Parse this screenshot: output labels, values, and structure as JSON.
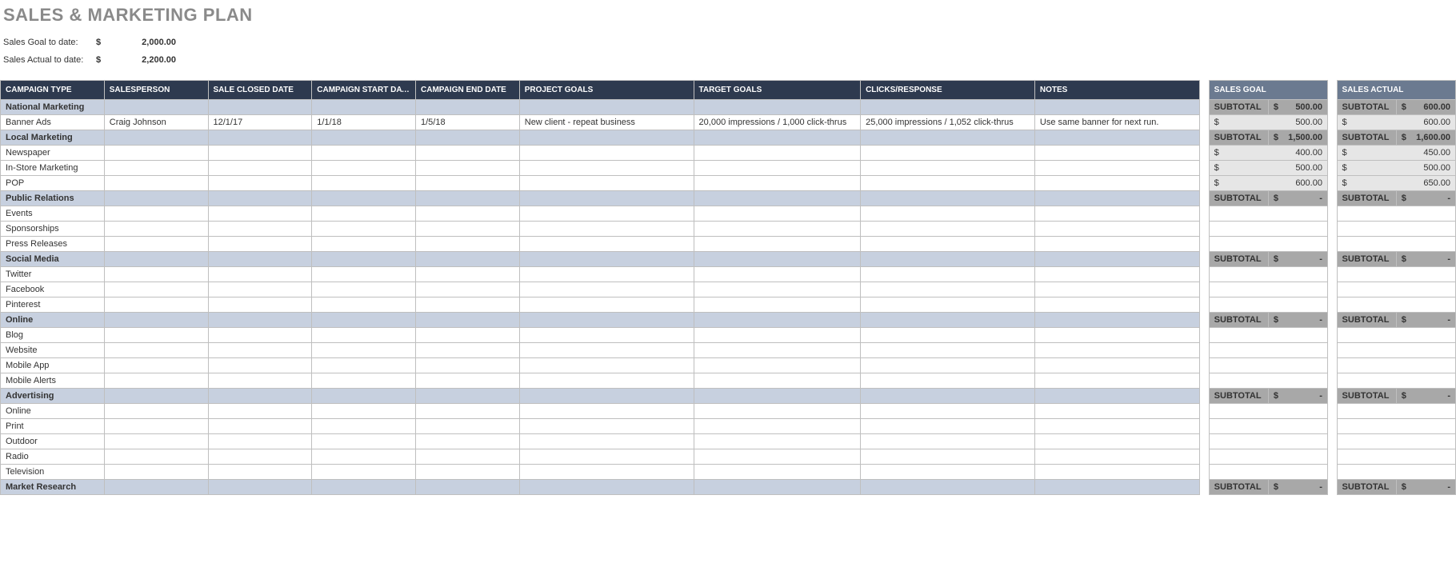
{
  "title": "SALES & MARKETING PLAN",
  "summary": {
    "goal_label": "Sales Goal to date:",
    "goal_sym": "$",
    "goal_val": "2,000.00",
    "actual_label": "Sales Actual to date:",
    "actual_sym": "$",
    "actual_val": "2,200.00"
  },
  "headers": {
    "campaign_type": "CAMPAIGN TYPE",
    "salesperson": "SALESPERSON",
    "sale_closed": "SALE CLOSED DATE",
    "start": "CAMPAIGN START DATE",
    "end": "CAMPAIGN END DATE",
    "project_goals": "PROJECT GOALS",
    "target_goals": "TARGET GOALS",
    "clicks": "CLICKS/RESPONSE",
    "notes": "NOTES",
    "sales_goal": "SALES GOAL",
    "sales_actual": "SALES ACTUAL"
  },
  "subtotal_label": "SUBTOTAL",
  "sections": [
    {
      "name": "National Marketing",
      "goal": "500.00",
      "actual": "600.00",
      "items": [
        {
          "type": "Banner Ads",
          "salesperson": "Craig Johnson",
          "closed": "12/1/17",
          "start": "1/1/18",
          "end": "1/5/18",
          "project": "New client - repeat business",
          "target": "20,000 impressions / 1,000 click-thrus",
          "clicks": "25,000 impressions / 1,052 click-thrus",
          "notes": "Use same banner for next run.",
          "goal": "500.00",
          "actual": "600.00"
        }
      ]
    },
    {
      "name": "Local Marketing",
      "goal": "1,500.00",
      "actual": "1,600.00",
      "items": [
        {
          "type": "Newspaper",
          "goal": "400.00",
          "actual": "450.00"
        },
        {
          "type": "In-Store Marketing",
          "goal": "500.00",
          "actual": "500.00"
        },
        {
          "type": "POP",
          "goal": "600.00",
          "actual": "650.00"
        }
      ]
    },
    {
      "name": "Public Relations",
      "goal": "-",
      "actual": "-",
      "items": [
        {
          "type": "Events"
        },
        {
          "type": "Sponsorships"
        },
        {
          "type": "Press Releases"
        }
      ]
    },
    {
      "name": "Social Media",
      "goal": "-",
      "actual": "-",
      "items": [
        {
          "type": "Twitter"
        },
        {
          "type": "Facebook"
        },
        {
          "type": "Pinterest"
        }
      ]
    },
    {
      "name": "Online",
      "goal": "-",
      "actual": "-",
      "items": [
        {
          "type": "Blog"
        },
        {
          "type": "Website"
        },
        {
          "type": "Mobile App"
        },
        {
          "type": "Mobile Alerts"
        }
      ]
    },
    {
      "name": "Advertising",
      "goal": "-",
      "actual": "-",
      "items": [
        {
          "type": "Online"
        },
        {
          "type": "Print"
        },
        {
          "type": "Outdoor"
        },
        {
          "type": "Radio"
        },
        {
          "type": "Television"
        }
      ]
    },
    {
      "name": "Market Research",
      "goal": "-",
      "actual": "-",
      "items": []
    }
  ]
}
